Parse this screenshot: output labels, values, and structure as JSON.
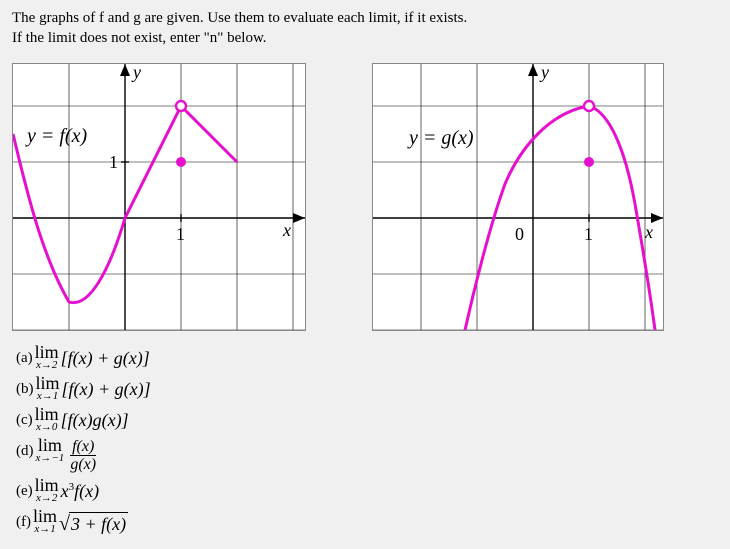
{
  "instructions": {
    "line1": "The graphs of f and g are given. Use them to evaluate each limit, if it exists.",
    "line2": "If the limit does not exist, enter \"n\" below."
  },
  "graph_f": {
    "fn_label": "y = f(x)",
    "axis_y": "y",
    "axis_x": "x",
    "tick_x": "1",
    "tick_y": "1"
  },
  "graph_g": {
    "fn_label": "y = g(x)",
    "axis_y": "y",
    "axis_x": "x",
    "tick_zero": "0",
    "tick_x": "1"
  },
  "questions": {
    "a": {
      "tag": "(a)",
      "sub": "x→2",
      "expr": "[f(x) + g(x)]"
    },
    "b": {
      "tag": "(b)",
      "sub": "x→1",
      "expr": "[f(x) + g(x)]"
    },
    "c": {
      "tag": "(c)",
      "sub": "x→0",
      "expr": "[f(x)g(x)]"
    },
    "d": {
      "tag": "(d)",
      "sub": "x→−1",
      "num": "f(x)",
      "den": "g(x)"
    },
    "e": {
      "tag": "(e)",
      "sub": "x→2",
      "expr1": "x",
      "exp": "3",
      "expr2": "f(x)"
    },
    "f": {
      "tag": "(f)",
      "sub": "x→1",
      "radicand": "3 + f(x)"
    }
  },
  "lim_text": "lim",
  "chart_data": [
    {
      "type": "line",
      "title": "y = f(x)",
      "xlabel": "x",
      "ylabel": "y",
      "xlim": [
        -2,
        3.2
      ],
      "ylim": [
        -2,
        2.75
      ],
      "grid": true,
      "segments": [
        {
          "kind": "curve",
          "approx_points": [
            [
              -2,
              1.5
            ],
            [
              -1.6,
              0
            ],
            [
              -1.4,
              -0.7
            ],
            [
              -1,
              -1.5
            ],
            [
              -0.6,
              -1.2
            ],
            [
              0,
              0
            ]
          ]
        },
        {
          "kind": "line",
          "from": [
            0,
            0
          ],
          "to": [
            1,
            2
          ]
        },
        {
          "kind": "line",
          "from": [
            1,
            2
          ],
          "to": [
            2,
            1
          ]
        }
      ],
      "points": [
        {
          "x": 1,
          "y": 2,
          "style": "open"
        },
        {
          "x": 1,
          "y": 1,
          "style": "filled"
        }
      ],
      "ticks_x": [
        1
      ],
      "ticks_y": [
        1
      ]
    },
    {
      "type": "line",
      "title": "y = g(x)",
      "xlabel": "x",
      "ylabel": "y",
      "xlim": [
        -2,
        2.2
      ],
      "ylim": [
        -3,
        2.75
      ],
      "grid": true,
      "segments": [
        {
          "kind": "curve",
          "approx_points": [
            [
              -1.2,
              -3
            ],
            [
              -1,
              -2
            ],
            [
              -0.5,
              0
            ],
            [
              0,
              1.35
            ],
            [
              0.5,
              1.8
            ],
            [
              1,
              2
            ]
          ]
        },
        {
          "kind": "curve",
          "approx_points": [
            [
              1,
              2
            ],
            [
              1.3,
              1.7
            ],
            [
              1.6,
              0.8
            ],
            [
              1.85,
              -0.6
            ],
            [
              2,
              -2.2
            ]
          ]
        }
      ],
      "points": [
        {
          "x": 1,
          "y": 2,
          "style": "open"
        },
        {
          "x": 1,
          "y": 1,
          "style": "filled"
        }
      ],
      "ticks_x": [
        0,
        1
      ],
      "ticks_y": []
    }
  ]
}
